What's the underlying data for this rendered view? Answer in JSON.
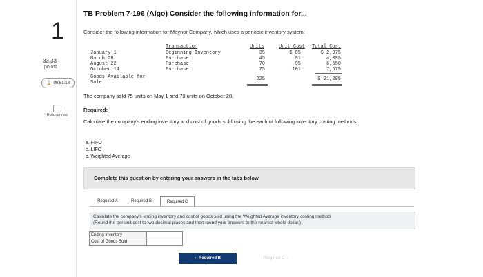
{
  "question": {
    "number": "1",
    "points": "33.33",
    "points_label": "points",
    "timer": "00:51:18",
    "references_label": "References"
  },
  "header": {
    "title": "TB Problem 7-196 (Algo) Consider the following information for..."
  },
  "intro": "Consider the following information for Maynor Company, which uses a periodic inventory system:",
  "inventory_table": {
    "headers": {
      "transaction": "Transaction",
      "units": "Units",
      "unit_cost": "Unit Cost",
      "total_cost": "Total Cost"
    },
    "rows": [
      {
        "date": "January 1",
        "transaction": "Beginning Inventory",
        "units": "35",
        "unit_cost": "$ 85",
        "total_cost": "$ 2,975"
      },
      {
        "date": "March 28",
        "transaction": "Purchase",
        "units": "45",
        "unit_cost": "91",
        "total_cost": "4,095"
      },
      {
        "date": "August 22",
        "transaction": "Purchase",
        "units": "70",
        "unit_cost": "95",
        "total_cost": "6,650"
      },
      {
        "date": "October 14",
        "transaction": "Purchase",
        "units": "75",
        "unit_cost": "101",
        "total_cost": "7,575"
      }
    ],
    "goods_available_label": "Goods Available for",
    "goods_available_label2": "Sale",
    "total_units": "225",
    "total_cost": "$ 21,295"
  },
  "sold_text": "The company sold 75 units on May 1 and 70 units on October 28.",
  "required_label": "Required:",
  "calc_text": "Calculate the company's ending inventory and cost of goods sold using the each of following inventory costing methods.",
  "methods": [
    "a. FIFO",
    "b. LIFO",
    "c. Weighted Average"
  ],
  "banner": "Complete this question by entering your answers in the tabs below.",
  "tabs": [
    "Required A",
    "Required B",
    "Required C"
  ],
  "instructions": {
    "line1": "Calculate the company's ending inventory and cost of goods sold using the Weighted Average inventory costing method.",
    "line2": "(Round the per unit cost to two decimal places and then round your answers to the nearest whole dollar.)"
  },
  "answer_rows": [
    {
      "label": "Ending Inventory",
      "value": ""
    },
    {
      "label": "Cost of Goods Sold",
      "value": ""
    }
  ],
  "nav": {
    "prev_label": "Required B",
    "next_label": "Required C"
  }
}
